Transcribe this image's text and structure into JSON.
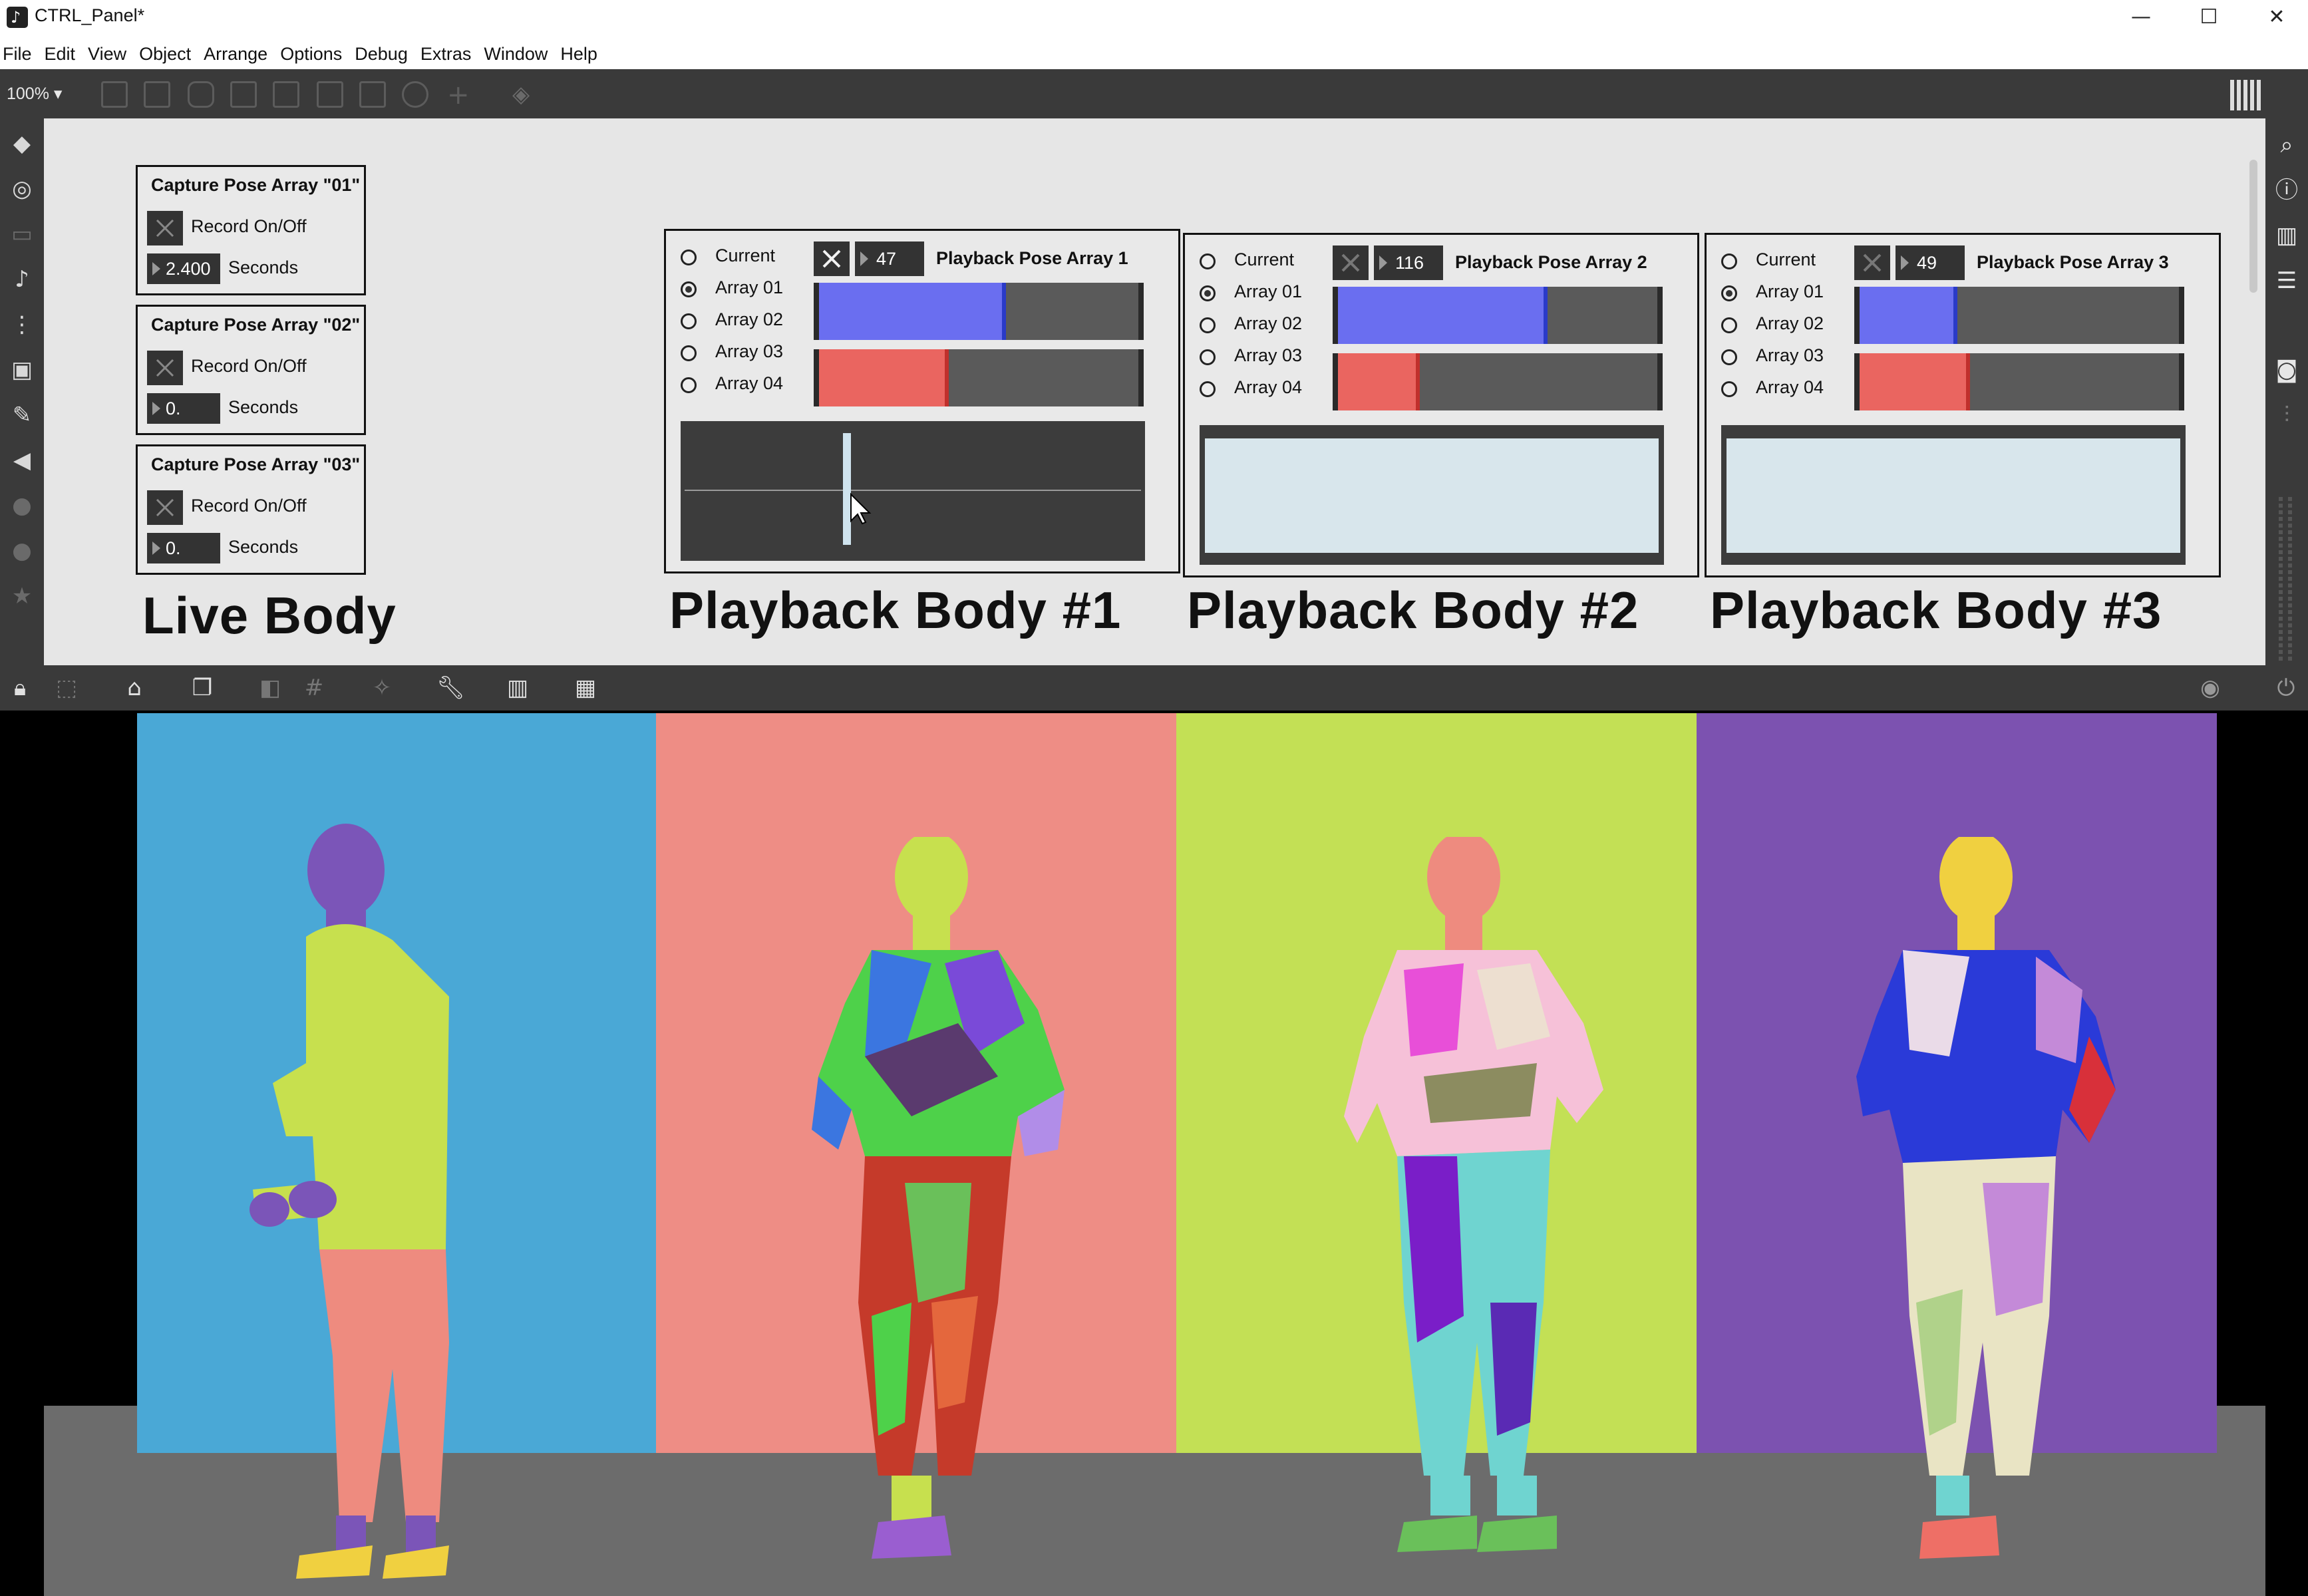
{
  "window": {
    "title": "CTRL_Panel*",
    "minimize_glyph": "—",
    "maximize_glyph": "☐",
    "close_glyph": "✕"
  },
  "menu": [
    "File",
    "Edit",
    "View",
    "Object",
    "Arrange",
    "Options",
    "Debug",
    "Extras",
    "Window",
    "Help"
  ],
  "toolbar": {
    "zoom": "100%",
    "zoom_caret": "▾"
  },
  "capture": [
    {
      "title": "Capture Pose Array \"01\"",
      "record_label": "Record On/Off",
      "seconds_value": "2.400",
      "seconds_label": "Seconds"
    },
    {
      "title": "Capture Pose Array \"02\"",
      "record_label": "Record On/Off",
      "seconds_value": "0.",
      "seconds_label": "Seconds"
    },
    {
      "title": "Capture Pose Array \"03\"",
      "record_label": "Record On/Off",
      "seconds_value": "0.",
      "seconds_label": "Seconds"
    }
  ],
  "live_body_title": "Live Body",
  "playback": [
    {
      "title": "Playback Pose Array  1",
      "number": "47",
      "options": [
        "Current",
        "Array 01",
        "Array 02",
        "Array 03",
        "Array 04"
      ],
      "selected": "Array 01",
      "blue_level": 0.58,
      "red_level": 0.4,
      "section_title": "Playback Body #1",
      "scope": "waveform",
      "scope_marker_level": 0.35
    },
    {
      "title": "Playback Pose Array  2",
      "number": "116",
      "options": [
        "Current",
        "Array 01",
        "Array 02",
        "Array 03",
        "Array 04"
      ],
      "selected": "Array 01",
      "blue_level": 0.65,
      "red_level": 0.25,
      "section_title": "Playback Body #2",
      "scope": "blank"
    },
    {
      "title": "Playback Pose Array  3",
      "number": "49",
      "options": [
        "Current",
        "Array 01",
        "Array 02",
        "Array 03",
        "Array 04"
      ],
      "selected": "Array 01",
      "blue_level": 0.3,
      "red_level": 0.34,
      "section_title": "Playback Body #3",
      "scope": "blank"
    }
  ],
  "colors": {
    "slider_blue": "#6a6ef0",
    "slider_red": "#ea6560",
    "slider_track": "#5a5a5a",
    "scope_dark": "#3c3c3c",
    "scope_light": "#d8e6ec",
    "stripe_1": "#4aa8d6",
    "stripe_2": "#ee8d85",
    "stripe_3": "#c3e055",
    "stripe_4": "#7c52b0",
    "floor": "#6c6c6c"
  },
  "icons": {
    "left_dock": [
      "objects-icon",
      "target-icon",
      "keyboard-icon",
      "music-note-icon",
      "sequence-icon",
      "image-icon",
      "paperclip-icon",
      "plugin-icon",
      "disabled-icon",
      "disabled-icon-2",
      "star-icon"
    ],
    "right_dock": [
      "search-icon",
      "info-icon",
      "book-icon",
      "list-icon",
      "camera-icon",
      "mixer-icon"
    ],
    "bottom_bar": [
      "lock-icon",
      "edit-mode-icon",
      "presentation-icon",
      "windows-icon",
      "hide-icon",
      "grid-icon",
      "snap-icon",
      "wrench-icon",
      "piano-icon",
      "keyboard-grid-icon",
      "play-icon",
      "power-icon"
    ]
  }
}
